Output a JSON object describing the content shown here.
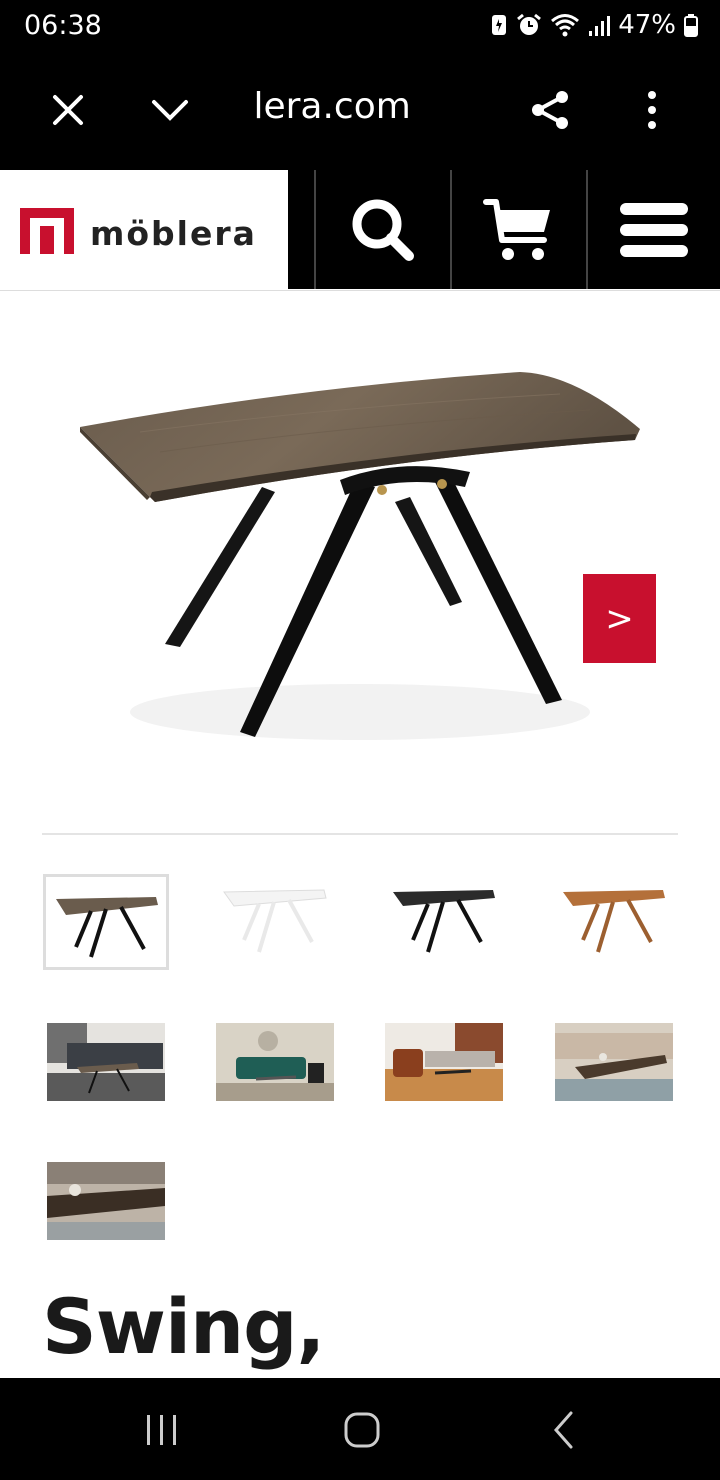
{
  "status": {
    "time": "06:38",
    "battery": "47%"
  },
  "browser": {
    "url": " lera.com",
    "close_label": "close",
    "expand_label": "expand"
  },
  "site": {
    "logo_text": "möblera"
  },
  "colors": {
    "brand_red": "#c8102e",
    "black": "#000000"
  },
  "gallery": {
    "next_label": ">",
    "thumbnails": [
      {
        "alt": "table-walnut"
      },
      {
        "alt": "table-white"
      },
      {
        "alt": "table-black"
      },
      {
        "alt": "table-oak"
      },
      {
        "alt": "room-1"
      },
      {
        "alt": "room-2"
      },
      {
        "alt": "room-3"
      },
      {
        "alt": "room-4"
      },
      {
        "alt": "room-5"
      }
    ]
  },
  "product": {
    "title": "Swing,"
  },
  "icons": {
    "close": "close-icon",
    "chevron": "chevron-down-icon",
    "share": "share-icon",
    "more": "more-vert-icon",
    "search": "search-icon",
    "cart": "cart-icon",
    "menu": "menu-icon",
    "recent": "recent-apps-icon",
    "home": "home-icon",
    "back": "back-icon"
  }
}
